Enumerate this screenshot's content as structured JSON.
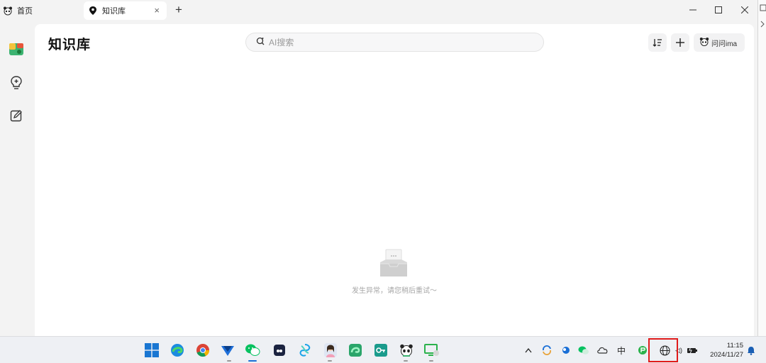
{
  "tabs": [
    {
      "label": "首页",
      "icon": "panda-icon"
    },
    {
      "label": "知识库",
      "icon": "map-pin-icon",
      "close": "×"
    }
  ],
  "new_tab": "+",
  "page": {
    "title": "知识库",
    "search_placeholder": "AI搜索",
    "ask_label": "问问ima",
    "empty_message": "发生异常，请您稍后重试～"
  },
  "rail": [
    {
      "name": "knowledge-base",
      "icon": "knowledge-base-icon"
    },
    {
      "name": "ideas",
      "icon": "lightbulb-icon"
    },
    {
      "name": "edit",
      "icon": "edit-icon"
    }
  ],
  "taskbar": {
    "apps": [
      "windows-start",
      "edge",
      "chrome",
      "bird-app",
      "wechat",
      "dark-app",
      "spiral-app",
      "avatar-app",
      "edge-dev",
      "key-app",
      "panda-app",
      "monitor-app"
    ],
    "active_app": "wechat",
    "tray_ime": "中",
    "tray_volume": "◁)",
    "time": "11:15",
    "date": "2024/11/27"
  },
  "colors": {
    "accent": "#1a6fd6",
    "highlight": "#e01b1b",
    "background": "#f3f3f3"
  }
}
